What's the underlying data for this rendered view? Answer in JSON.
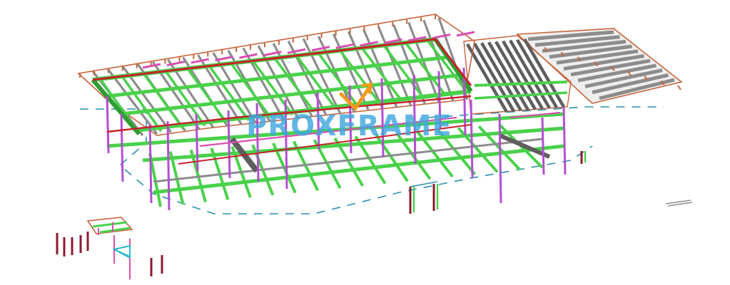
{
  "watermark": {
    "logo_text": "PROXFRAME",
    "logo_color": "#3fa6de",
    "accent_color": "#f39a1e"
  },
  "colors": {
    "beam_green": "#49d14a",
    "beam_green_dark": "#2f9d33",
    "column_purple": "#b24fd1",
    "joist_grey": "#8c8c8c",
    "joist_grey_dark": "#5e5e5e",
    "edge_orange": "#c8643a",
    "edge_red": "#c8202a",
    "slab_teal": "#2a8fb0",
    "pink_member": "#d84fb0",
    "bracing_cyan": "#29b9c9",
    "dark_red_column": "#8b1a2e",
    "background": "#ffffff"
  },
  "icons": {
    "watermark": "proxframe-logo-icon"
  }
}
